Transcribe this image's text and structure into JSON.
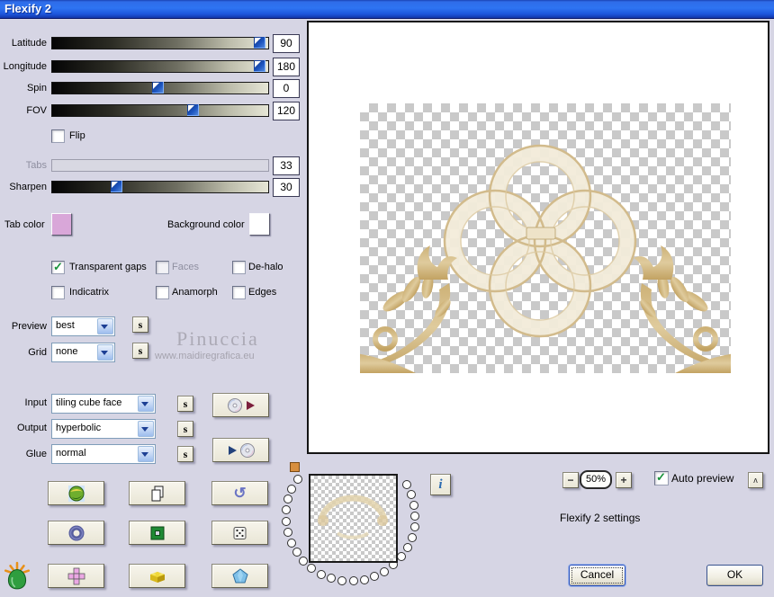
{
  "window": {
    "title": "Flexify 2"
  },
  "sliders": [
    {
      "label": "Latitude",
      "value": "90",
      "disabled": false
    },
    {
      "label": "Longitude",
      "value": "180",
      "disabled": false
    },
    {
      "label": "Spin",
      "value": "0",
      "disabled": false
    },
    {
      "label": "FOV",
      "value": "120",
      "disabled": false
    },
    {
      "label": "Tabs",
      "value": "33",
      "disabled": true
    },
    {
      "label": "Sharpen",
      "value": "30",
      "disabled": false
    }
  ],
  "flip_label": "Flip",
  "color_pickers": {
    "tab_label": "Tab color",
    "tab_color": "#d9a7d9",
    "bg_label": "Background color",
    "bg_color": "#ffffff"
  },
  "options": {
    "transparent_gaps": {
      "label": "Transparent gaps",
      "checked": true,
      "disabled": false
    },
    "faces": {
      "label": "Faces",
      "checked": false,
      "disabled": true
    },
    "dehalo": {
      "label": "De-halo",
      "checked": false,
      "disabled": false
    },
    "indicatrix": {
      "label": "Indicatrix",
      "checked": false,
      "disabled": false
    },
    "anamorph": {
      "label": "Anamorph",
      "checked": false,
      "disabled": false
    },
    "edges": {
      "label": "Edges",
      "checked": false,
      "disabled": false
    }
  },
  "preview_select": {
    "label": "Preview",
    "value": "best"
  },
  "grid_select": {
    "label": "Grid",
    "value": "none"
  },
  "io": {
    "input": {
      "label": "Input",
      "value": "tiling cube face"
    },
    "output": {
      "label": "Output",
      "value": "hyperbolic"
    },
    "glue": {
      "label": "Glue",
      "value": "normal"
    }
  },
  "watermark": {
    "line1": "Pinuccia",
    "line2": "www.maidiregrafica.eu"
  },
  "zoom_controls": {
    "minus": "−",
    "level": "50%",
    "plus": "+"
  },
  "auto_preview": {
    "label": "Auto preview",
    "checked": true
  },
  "settings_caption": "Flexify 2 settings",
  "actions": {
    "cancel": "Cancel",
    "ok": "OK"
  },
  "icons": {
    "s": "s",
    "info": "i",
    "collapse": "ʌ"
  }
}
